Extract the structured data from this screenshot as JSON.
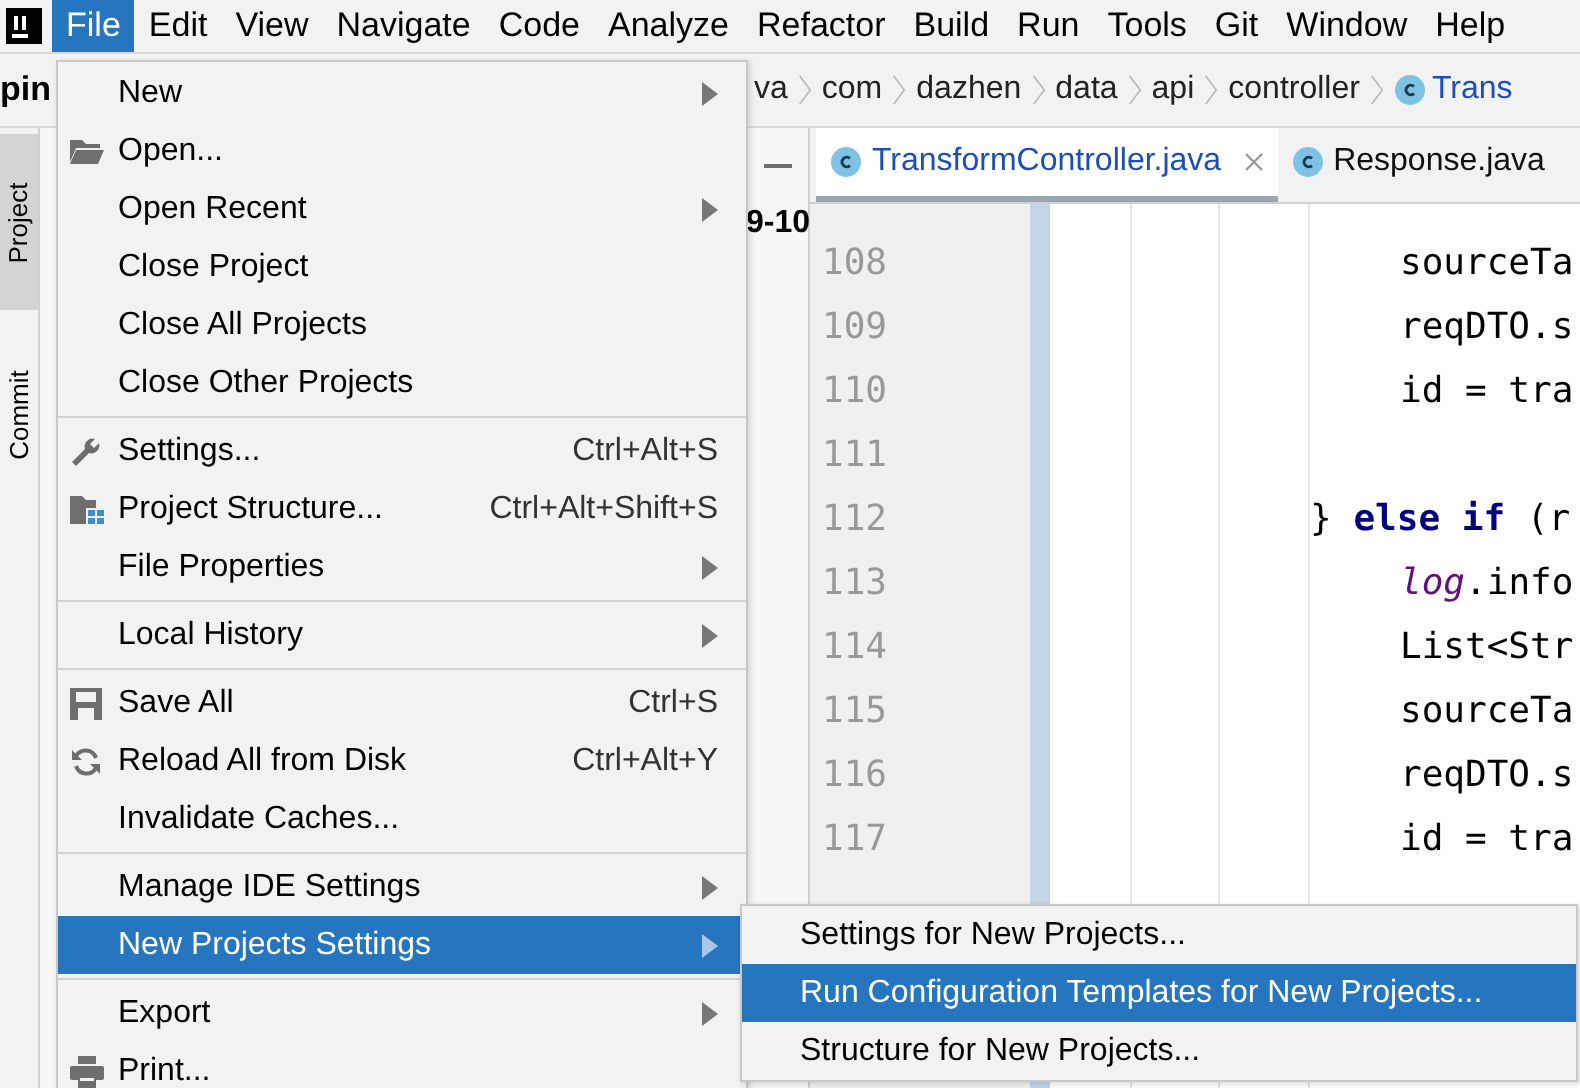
{
  "menubar": {
    "items": [
      {
        "label": "File",
        "selected": true
      },
      {
        "label": "Edit",
        "selected": false
      },
      {
        "label": "View",
        "selected": false
      },
      {
        "label": "Navigate",
        "selected": false
      },
      {
        "label": "Code",
        "selected": false
      },
      {
        "label": "Analyze",
        "selected": false
      },
      {
        "label": "Refactor",
        "selected": false
      },
      {
        "label": "Build",
        "selected": false
      },
      {
        "label": "Run",
        "selected": false
      },
      {
        "label": "Tools",
        "selected": false
      },
      {
        "label": "Git",
        "selected": false
      },
      {
        "label": "Window",
        "selected": false
      },
      {
        "label": "Help",
        "selected": false
      }
    ]
  },
  "project_title": "pin",
  "breadcrumb": [
    {
      "label": "va",
      "kind": "folder"
    },
    {
      "label": "com",
      "kind": "folder"
    },
    {
      "label": "dazhen",
      "kind": "folder"
    },
    {
      "label": "data",
      "kind": "folder"
    },
    {
      "label": "api",
      "kind": "folder"
    },
    {
      "label": "controller",
      "kind": "folder"
    },
    {
      "label": "Trans",
      "kind": "class"
    }
  ],
  "side_tabs": [
    {
      "label": "Project",
      "selected": true
    },
    {
      "label": "Commit",
      "selected": false
    }
  ],
  "project_panel": {
    "text": "9-10"
  },
  "editor_tabs": [
    {
      "label": "TransformController.java",
      "selected": true
    },
    {
      "label": "Response.java",
      "selected": false
    }
  ],
  "code_lines": [
    {
      "number": "108",
      "kind": "inner",
      "parts": [
        {
          "text": "sourceTa",
          "kind": "plain"
        }
      ]
    },
    {
      "number": "109",
      "kind": "inner",
      "parts": [
        {
          "text": "reqDTO.s",
          "kind": "plain"
        }
      ]
    },
    {
      "number": "110",
      "kind": "inner",
      "parts": [
        {
          "text": "id = tra",
          "kind": "plain"
        }
      ]
    },
    {
      "number": "111",
      "kind": "inner"
    },
    {
      "number": "112",
      "kind": "outer",
      "parts": [
        {
          "text": "} ",
          "kind": "plain"
        },
        {
          "text": "else if",
          "kind": "keyword"
        },
        {
          "text": " (r",
          "kind": "plain"
        }
      ]
    },
    {
      "number": "113",
      "kind": "inner",
      "parts": [
        {
          "text": "log",
          "kind": "field"
        },
        {
          "text": ".info",
          "kind": "plain"
        }
      ]
    },
    {
      "number": "114",
      "kind": "inner",
      "parts": [
        {
          "text": "List<Str",
          "kind": "plain"
        }
      ]
    },
    {
      "number": "115",
      "kind": "inner",
      "parts": [
        {
          "text": "sourceTa",
          "kind": "plain"
        }
      ]
    },
    {
      "number": "116",
      "kind": "inner",
      "parts": [
        {
          "text": "reqDTO.s",
          "kind": "plain"
        }
      ]
    },
    {
      "number": "117",
      "kind": "inner",
      "parts": [
        {
          "text": "id = tra",
          "kind": "plain"
        }
      ]
    }
  ],
  "file_menu": {
    "items": [
      {
        "kind": "item",
        "label": "New",
        "submenu": true,
        "selected": false
      },
      {
        "kind": "item",
        "label": "Open...",
        "selected": false
      },
      {
        "kind": "item",
        "label": "Open Recent",
        "submenu": true,
        "selected": false
      },
      {
        "kind": "item",
        "label": "Close Project",
        "selected": false
      },
      {
        "kind": "item",
        "label": "Close All Projects",
        "selected": false
      },
      {
        "kind": "item",
        "label": "Close Other Projects",
        "selected": false
      },
      {
        "kind": "separator"
      },
      {
        "kind": "item",
        "label": "Settings...",
        "shortcut": "Ctrl+Alt+S",
        "selected": false
      },
      {
        "kind": "item",
        "label": "Project Structure...",
        "shortcut": "Ctrl+Alt+Shift+S",
        "selected": false
      },
      {
        "kind": "item",
        "label": "File Properties",
        "submenu": true,
        "selected": false
      },
      {
        "kind": "separator"
      },
      {
        "kind": "item",
        "label": "Local History",
        "submenu": true,
        "selected": false
      },
      {
        "kind": "separator"
      },
      {
        "kind": "item",
        "label": "Save All",
        "shortcut": "Ctrl+S",
        "selected": false
      },
      {
        "kind": "item",
        "label": "Reload All from Disk",
        "shortcut": "Ctrl+Alt+Y",
        "selected": false
      },
      {
        "kind": "item",
        "label": "Invalidate Caches...",
        "selected": false
      },
      {
        "kind": "separator"
      },
      {
        "kind": "item",
        "label": "Manage IDE Settings",
        "submenu": true,
        "selected": false
      },
      {
        "kind": "item",
        "label": "New Projects Settings",
        "submenu": true,
        "selected": true
      },
      {
        "kind": "separator"
      },
      {
        "kind": "item",
        "label": "Export",
        "submenu": true,
        "selected": false
      },
      {
        "kind": "item",
        "label": "Print...",
        "selected": false
      }
    ]
  },
  "submenu": {
    "items": [
      {
        "label": "Settings for New Projects...",
        "selected": false
      },
      {
        "label": "Run Configuration Templates for New Projects...",
        "selected": true
      },
      {
        "label": "Structure for New Projects...",
        "selected": false
      }
    ]
  }
}
